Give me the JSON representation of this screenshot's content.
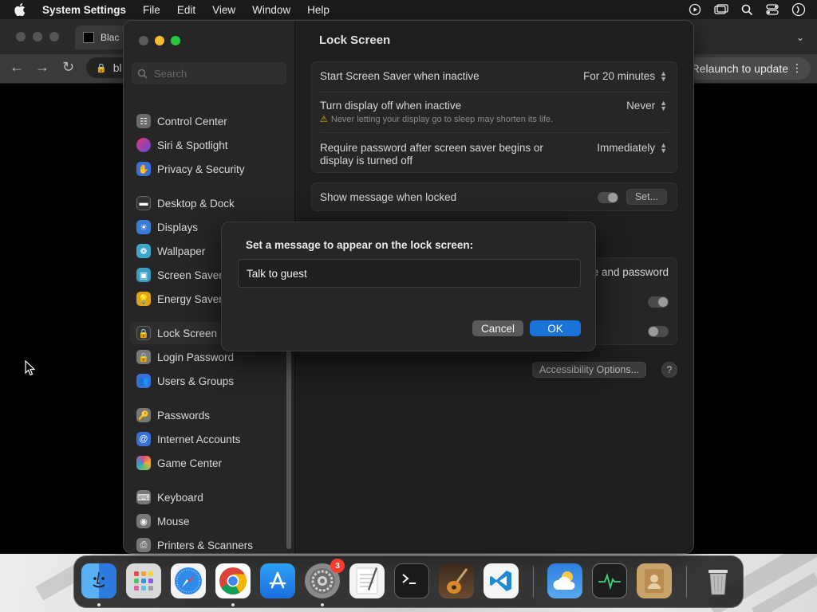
{
  "menubar": {
    "app_name": "System Settings",
    "items": [
      "File",
      "Edit",
      "View",
      "Window",
      "Help"
    ]
  },
  "browser": {
    "tab_title": "Blac",
    "url_text": "bl",
    "relaunch_label": "Relaunch to update"
  },
  "settings": {
    "search_placeholder": "Search",
    "sidebar": [
      {
        "label": "Control Center",
        "icon": "control-center-icon",
        "color": "#6b6b6b"
      },
      {
        "label": "Siri & Spotlight",
        "icon": "siri-icon",
        "color": "#c2368d"
      },
      {
        "label": "Privacy & Security",
        "icon": "hand-icon",
        "color": "#3a6fd8"
      },
      {
        "label": "Desktop & Dock",
        "icon": "dock-icon",
        "color": "#333333"
      },
      {
        "label": "Displays",
        "icon": "sun-icon",
        "color": "#3a7bd5"
      },
      {
        "label": "Wallpaper",
        "icon": "wallpaper-icon",
        "color": "#3fa6c9"
      },
      {
        "label": "Screen Saver",
        "icon": "screen-saver-icon",
        "color": "#3a9ec0"
      },
      {
        "label": "Energy Saver",
        "icon": "bulb-icon",
        "color": "#e0a516"
      },
      {
        "label": "Lock Screen",
        "icon": "lock-icon",
        "color": "#333333"
      },
      {
        "label": "Login Password",
        "icon": "lock-icon",
        "color": "#777777"
      },
      {
        "label": "Users & Groups",
        "icon": "users-icon",
        "color": "#3a6fd8"
      },
      {
        "label": "Passwords",
        "icon": "key-icon",
        "color": "#777777"
      },
      {
        "label": "Internet Accounts",
        "icon": "at-icon",
        "color": "#3a6fd8"
      },
      {
        "label": "Game Center",
        "icon": "game-center-icon",
        "color": "#d06aa0"
      },
      {
        "label": "Keyboard",
        "icon": "keyboard-icon",
        "color": "#777777"
      },
      {
        "label": "Mouse",
        "icon": "mouse-icon",
        "color": "#777777"
      },
      {
        "label": "Printers & Scanners",
        "icon": "printer-icon",
        "color": "#777777"
      }
    ],
    "main": {
      "title": "Lock Screen",
      "rows": {
        "screen_saver_label": "Start Screen Saver when inactive",
        "screen_saver_value": "For 20 minutes",
        "display_off_label": "Turn display off when inactive",
        "display_off_value": "Never",
        "display_off_warning": "Never letting your display go to sleep may shorten its life.",
        "require_password_label_1": "Require password after screen saver begins or",
        "require_password_label_2": "display is turned off",
        "require_password_value": "Immediately",
        "show_message_label": "Show message when locked",
        "set_button": "Set...",
        "partial_label": "e and password",
        "accessibility_button": "Accessibility Options...",
        "help_button": "?"
      }
    }
  },
  "dialog": {
    "prompt": "Set a message to appear on the lock screen:",
    "field_value": "Talk to guest",
    "cancel_label": "Cancel",
    "ok_label": "OK"
  },
  "dock": {
    "apps": [
      {
        "name": "finder-icon",
        "color": "#2e8ef0"
      },
      {
        "name": "launchpad-icon",
        "color": "#cfcfcf"
      },
      {
        "name": "safari-icon",
        "color": "#2f8bea"
      },
      {
        "name": "chrome-icon",
        "color": "#ffffff"
      },
      {
        "name": "app-store-icon",
        "color": "#1c8cf0"
      },
      {
        "name": "system-settings-icon",
        "color": "#8a8a8a",
        "badge": "3"
      },
      {
        "name": "textedit-icon",
        "color": "#efefef"
      },
      {
        "name": "terminal-icon",
        "color": "#1a1a1a"
      },
      {
        "name": "garageband-icon",
        "color": "#6e4b2e"
      },
      {
        "name": "vscode-icon",
        "color": "#ffffff"
      },
      {
        "name": "weather-icon",
        "color": "#2f7fe0"
      },
      {
        "name": "activity-monitor-icon",
        "color": "#1d1d1d"
      },
      {
        "name": "contacts-icon",
        "color": "#c9a46a"
      },
      {
        "name": "trash-icon",
        "color": "#bdbdbd"
      }
    ]
  }
}
